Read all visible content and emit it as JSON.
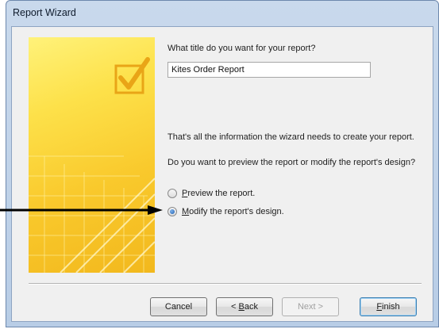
{
  "window": {
    "title": "Report Wizard"
  },
  "form": {
    "prompt": "What title do you want for your report?",
    "title_value": "Kites Order Report",
    "info_text": "That's all the information the wizard needs to create your report.",
    "question": "Do you want to preview the report or modify the report's design?",
    "options": [
      {
        "mnemonic": "P",
        "rest": "review the report.",
        "selected": false
      },
      {
        "mnemonic": "M",
        "rest": "odify the report's design.",
        "selected": true
      }
    ]
  },
  "buttons": {
    "cancel": "Cancel",
    "back_prefix": "< ",
    "back_mnemonic": "B",
    "back_rest": "ack",
    "next": "Next >",
    "finish_mnemonic": "F",
    "finish_rest": "inish"
  },
  "colors": {
    "accent_yellow": "#fde14a",
    "window_frame": "#b8cde6",
    "arrow": "#000000"
  },
  "icons": {
    "wizard_graphic": "checkbox-check-icon",
    "pointer": "arrow-right-icon"
  }
}
